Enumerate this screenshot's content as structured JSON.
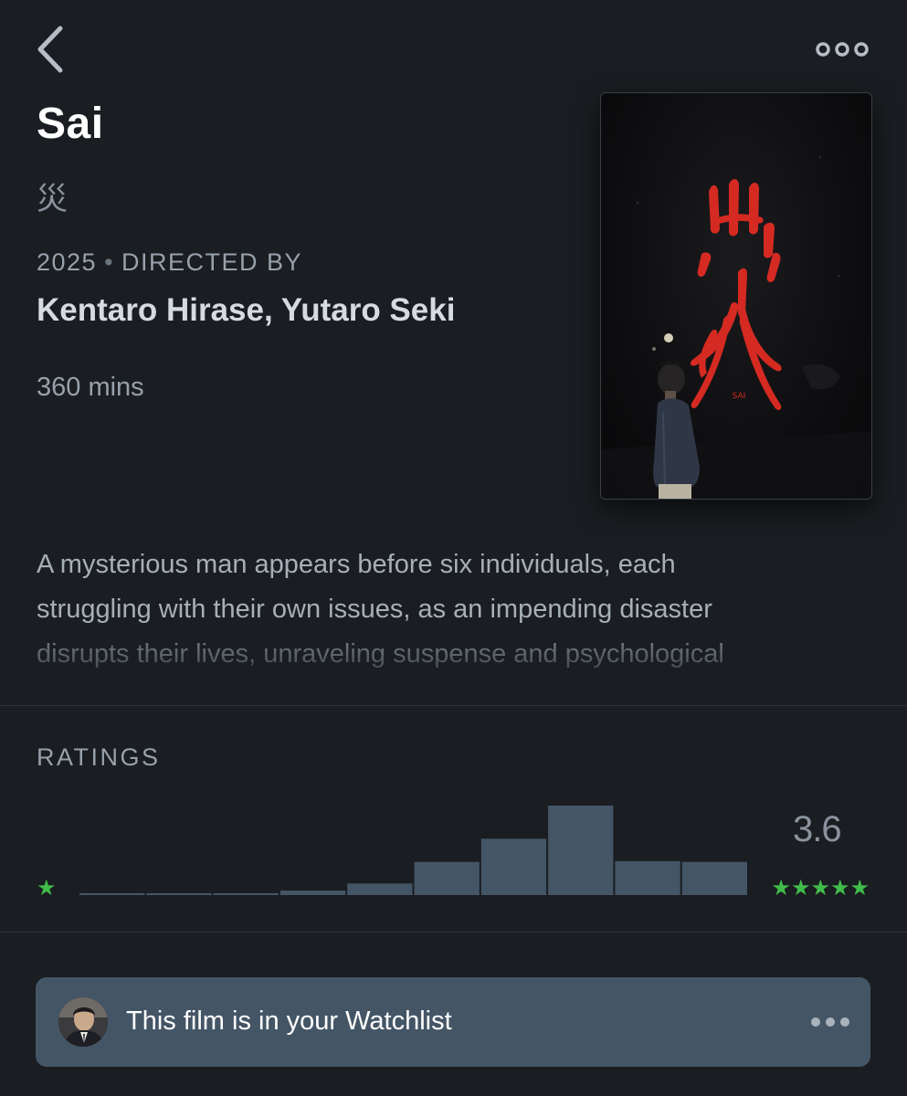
{
  "nav": {
    "back_icon": "chevron-left-icon",
    "more_icon": "more-dots-icon"
  },
  "film": {
    "title": "Sai",
    "original_title": "災",
    "year": "2025",
    "separator": "•",
    "directed_by_label": "DIRECTED BY",
    "directors": "Kentaro Hirase, Yutaro Seki",
    "runtime": "360 mins",
    "poster": {
      "glyph_color": "#d42a22",
      "caption": "SAI"
    },
    "synopsis_lines": [
      "A mysterious man appears before six individuals, each",
      "struggling with their own issues, as an impending disaster",
      "disrupts their lives, unraveling suspense and psychological"
    ]
  },
  "ratings": {
    "label": "RATINGS",
    "average": "3.6",
    "min_stars": "★",
    "max_stars": "★★★★★",
    "star_color": "#40bc4a",
    "bar_color": "#445566",
    "histogram": {
      "buckets": [
        "0.5",
        "1",
        "1.5",
        "2",
        "2.5",
        "3",
        "3.5",
        "4",
        "4.5",
        "5"
      ],
      "relative_counts": [
        0.02,
        0.02,
        0.02,
        0.05,
        0.13,
        0.37,
        0.63,
        1.0,
        0.38,
        0.37
      ]
    }
  },
  "watchlist": {
    "text": "This film is in your Watchlist",
    "avatar_icon": "user-avatar",
    "more_icon": "more-dots-icon"
  }
}
